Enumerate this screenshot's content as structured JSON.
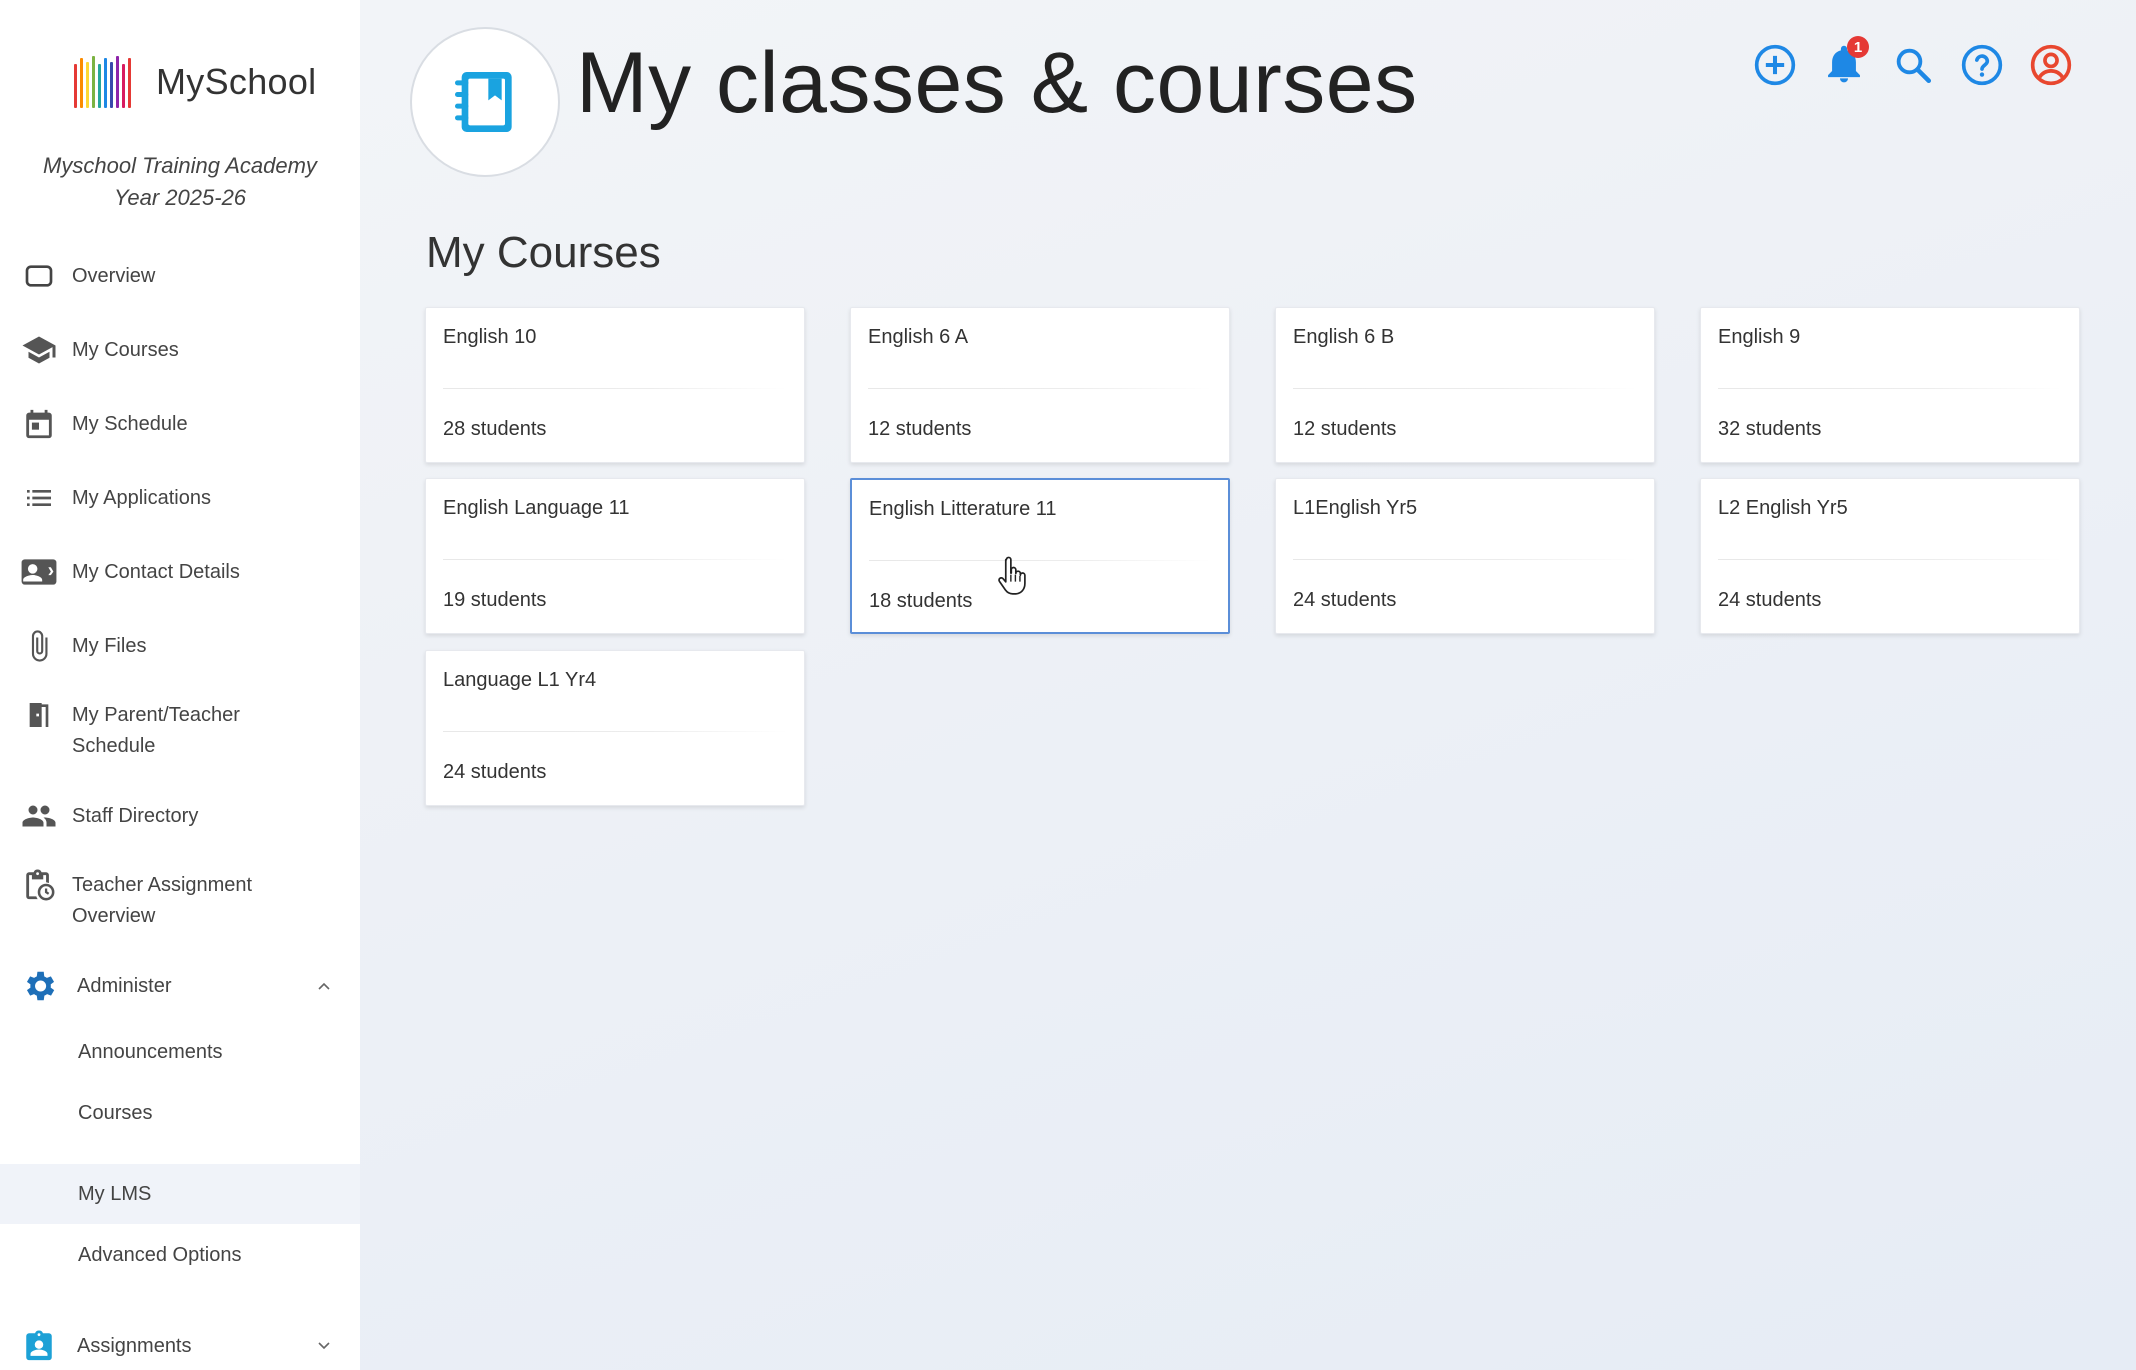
{
  "app": {
    "name": "MySchool",
    "school_name": "Myschool Training Academy",
    "school_year": "Year 2025-26"
  },
  "colors": {
    "accent_blue": "#1e88e5",
    "notification_red": "#e53935",
    "profile_red": "#e8472f",
    "selected_border": "#5b8ed8",
    "active_nav_bg": "#f0f3f9"
  },
  "sidebar": {
    "items": [
      {
        "label": "Overview",
        "icon": "overview-icon"
      },
      {
        "label": "My Courses",
        "icon": "graduation-cap-icon"
      },
      {
        "label": "My Schedule",
        "icon": "calendar-icon"
      },
      {
        "label": "My Applications",
        "icon": "list-icon"
      },
      {
        "label": "My Contact Details",
        "icon": "contact-card-icon"
      },
      {
        "label": "My Files",
        "icon": "paperclip-icon"
      },
      {
        "label": "My Parent/Teacher Schedule",
        "icon": "door-icon"
      },
      {
        "label": "Staff Directory",
        "icon": "people-icon"
      },
      {
        "label": "Teacher Assignment Overview",
        "icon": "clipboard-clock-icon"
      }
    ],
    "administer": {
      "label": "Administer",
      "icon": "gear-icon",
      "expanded": true,
      "subitems": [
        {
          "label": "Announcements"
        },
        {
          "label": "Courses"
        },
        {
          "label": "My LMS",
          "active": true
        },
        {
          "label": "Advanced Options"
        }
      ]
    },
    "assignments": {
      "label": "Assignments",
      "icon": "assignment-icon",
      "expanded": false
    }
  },
  "header": {
    "title": "My classes & courses",
    "badge_icon": "notebook-icon",
    "notification_count": "1",
    "icons": [
      "add-circle-icon",
      "bell-icon",
      "search-icon",
      "help-icon",
      "profile-icon"
    ]
  },
  "main": {
    "section_title": "My Courses",
    "courses": [
      {
        "name": "English 10",
        "students": "28 students"
      },
      {
        "name": "English 6 A",
        "students": "12 students"
      },
      {
        "name": "English 6 B",
        "students": "12 students"
      },
      {
        "name": "English 9",
        "students": "32 students"
      },
      {
        "name": "English Language 11",
        "students": "19 students"
      },
      {
        "name": "English Litterature 11",
        "students": "18 students",
        "selected": true
      },
      {
        "name": "L1English Yr5",
        "students": "24 students"
      },
      {
        "name": "L2 English Yr5",
        "students": "24 students"
      },
      {
        "name": "Language L1 Yr4",
        "students": "24 students"
      }
    ]
  }
}
